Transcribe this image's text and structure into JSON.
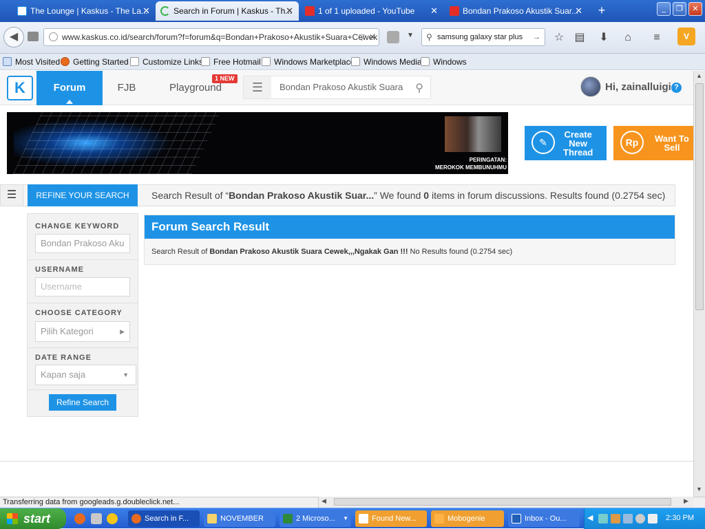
{
  "browser": {
    "tabs": [
      {
        "title": "The Lounge | Kaskus - The La...",
        "icon": "kaskus-favicon",
        "active": false
      },
      {
        "title": "Search in Forum | Kaskus - Th...",
        "icon": "loading-spinner",
        "active": true
      },
      {
        "title": "1 of 1 uploaded - YouTube",
        "icon": "youtube-favicon",
        "active": false
      },
      {
        "title": "Bondan Prakoso Akustik Suar...",
        "icon": "youtube-favicon",
        "active": false
      }
    ],
    "new_tab": "+",
    "url": "www.kaskus.co.id/search/forum?f=forum&q=Bondan+Prakoso+Akustik+Suara+Cewek",
    "search_value": "samsung galaxy star plus",
    "bookmarks": [
      "Most Visited",
      "Getting Started",
      "Customize Links",
      "Free Hotmail",
      "Windows Marketplace",
      "Windows Media",
      "Windows"
    ],
    "status_text": "Transferring data from googleads.g.doubleclick.net..."
  },
  "site": {
    "logo": "K",
    "nav": {
      "forum": "Forum",
      "fjb": "FJB",
      "playground": "Playground",
      "new_badge": "1 NEW"
    },
    "search_query": "Bondan Prakoso Akustik Suara C",
    "greeting": "Hi, zainalluigi",
    "help": "?",
    "banner": {
      "warning_line1": "PERINGATAN:",
      "warning_line2": "MEROKOK MEMBUNUHMU"
    },
    "create_thread": {
      "line1": "Create",
      "line2": "New",
      "line3": "Thread"
    },
    "want_to_sell": {
      "line1": "Want To",
      "line2": "Sell",
      "icon_text": "Rp"
    },
    "refine_tab": "REFINE YOUR SEARCH",
    "result_summary": {
      "prefix": "Search Result of “",
      "query": "Bondan Prakoso Akustik Suar...",
      "mid": "” We found ",
      "count": "0",
      "suffix": " items in forum discussions. Results found (0.2754 sec)"
    },
    "sidebar": {
      "keyword_label": "CHANGE KEYWORD",
      "keyword_value": "Bondan Prakoso Aku",
      "username_label": "USERNAME",
      "username_placeholder": "Username",
      "category_label": "CHOOSE CATEGORY",
      "category_value": "Pilih Kategori",
      "date_label": "DATE RANGE",
      "date_value": "Kapan saja",
      "refine_button": "Refine Search"
    },
    "result_panel": {
      "title": "Forum Search Result",
      "msg_prefix": "Search Result of ",
      "msg_query": "Bondan Prakoso Akustik Suara Cewek,,,Ngakak Gan !!!",
      "msg_suffix": " No Results found (0.2754 sec)"
    }
  },
  "taskbar": {
    "start": "start",
    "items": [
      "Search in F...",
      "NOVEMBER",
      "2 Microso...",
      "Found New...",
      "Mobogenie",
      "Inbox - Ou..."
    ],
    "clock": "2:30 PM"
  }
}
